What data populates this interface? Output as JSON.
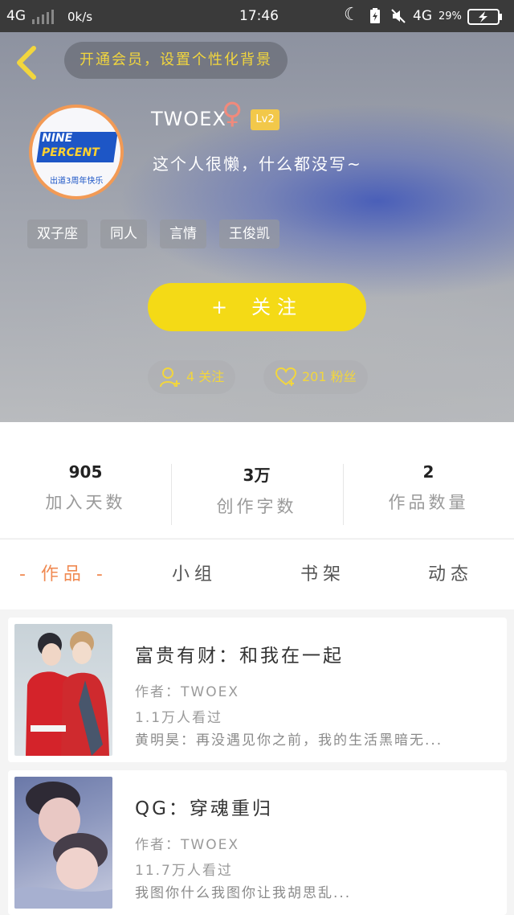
{
  "status_bar": {
    "network_left": "4G",
    "speed": "0k/s",
    "time": "17:46",
    "network_right": "4G",
    "battery": "29%"
  },
  "header": {
    "vip_banner": "开通会员，设置个性化背景",
    "username": "TWOEX",
    "gender_symbol": "♀",
    "level": "Lv2",
    "bio": "这个人很懒，什么都没写~",
    "tags": [
      "双子座",
      "同人",
      "言情",
      "王俊凯"
    ],
    "follow_button": "关注",
    "follow_button_plus": "+",
    "following_label": "4 关注",
    "fans_label": "201 粉丝",
    "avatar_text": {
      "line1": "NINE",
      "line2": "PERCENT",
      "line3": "出道3周年快乐"
    }
  },
  "stats": [
    {
      "value": "905",
      "label": "加入天数"
    },
    {
      "value": "3万",
      "label": "创作字数"
    },
    {
      "value": "2",
      "label": "作品数量"
    }
  ],
  "tabs": [
    {
      "label": "- 作品 -",
      "active": true
    },
    {
      "label": "小组",
      "active": false
    },
    {
      "label": "书架",
      "active": false
    },
    {
      "label": "动态",
      "active": false
    }
  ],
  "works": [
    {
      "title": "富贵有财：和我在一起",
      "author": "作者：TWOEX",
      "views": "1.1万人看过",
      "excerpt": "黄明昊：再没遇见你之前，我的生活黑暗无..."
    },
    {
      "title": "QG：穿魂重归",
      "author": "作者：TWOEX",
      "views": "11.7万人看过",
      "excerpt": "我图你什么我图你让我胡思乱..."
    }
  ],
  "colors": {
    "accent_yellow": "#f4da16",
    "tab_active": "#f08a52",
    "status_bar_bg": "#3a3a3a"
  }
}
